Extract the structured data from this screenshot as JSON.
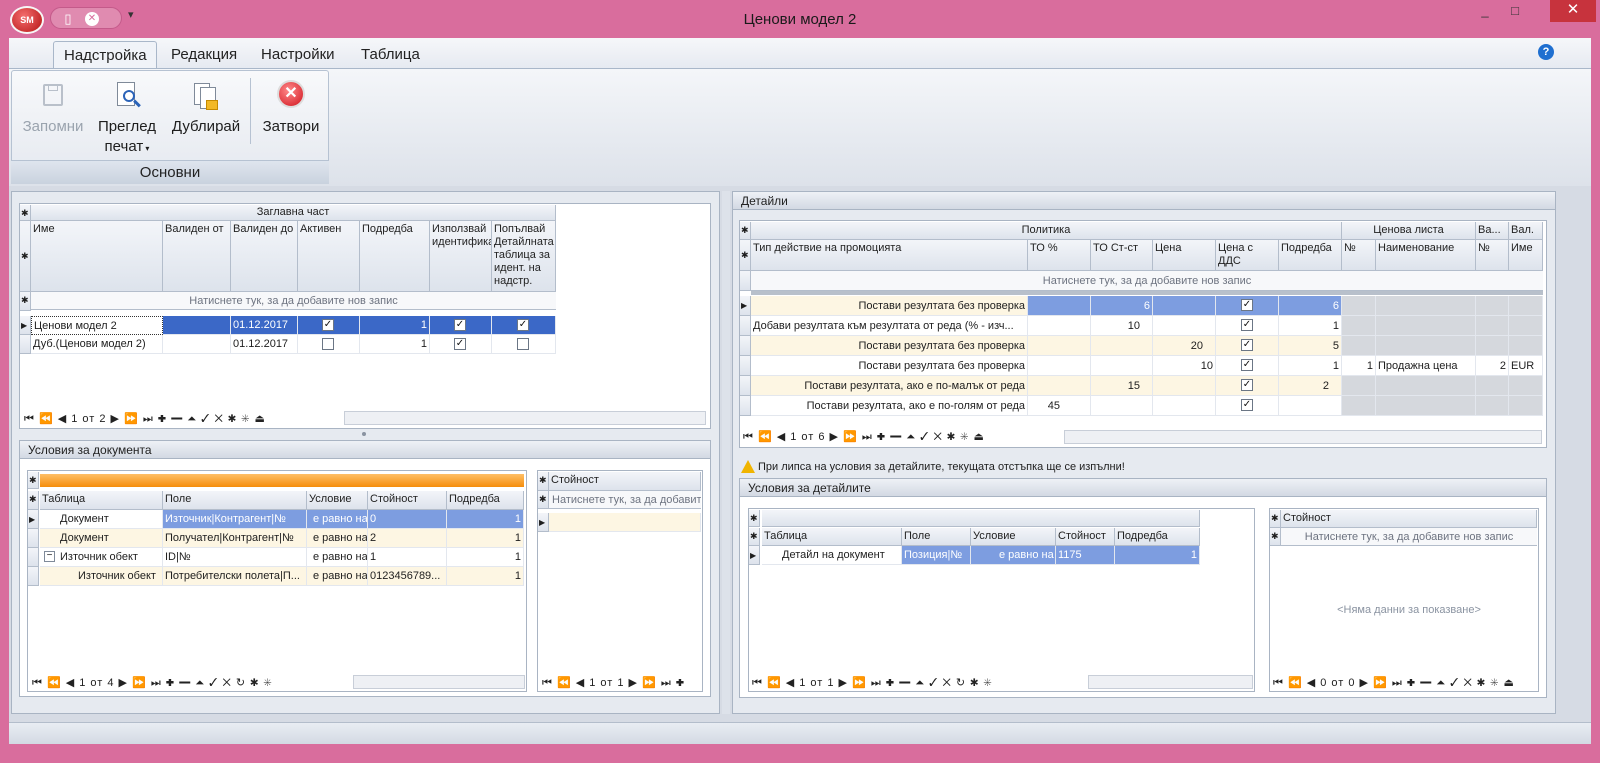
{
  "window": {
    "title": "Ценови модел 2",
    "app_badge": "SM",
    "minimize": "_",
    "maximize": "□",
    "close": "✕"
  },
  "ribbon": {
    "tabs": [
      "Надстройка",
      "Редакция",
      "Настройки",
      "Таблица"
    ],
    "help": "?",
    "buttons": {
      "save": "Запомни",
      "preview_line1": "Преглед",
      "preview_line2": "печат",
      "duplicate": "Дублирай",
      "close": "Затвори"
    },
    "group_label": "Основни"
  },
  "header_grid": {
    "band": "Заглавна част",
    "columns": [
      "Име",
      "Валиден от",
      "Валиден до",
      "Активен",
      "Подредба",
      "Използвай идентификатора",
      "Попълвай Детайлната таблица за идент. на надстр."
    ],
    "add_row": "Натиснете тук, за да добавите нов запис",
    "rows": [
      {
        "name": "Ценови модел 2",
        "from": "",
        "to": "01.12.2017",
        "active": true,
        "order": "1",
        "use_id": true,
        "fill": true
      },
      {
        "name": "Дуб.(Ценови модел 2)",
        "from": "",
        "to": "01.12.2017",
        "active": false,
        "order": "1",
        "use_id": true,
        "fill": false
      }
    ],
    "nav": "1 от 2"
  },
  "doc_conditions": {
    "title": "Условия за документа",
    "columns": [
      "Таблица",
      "Поле",
      "Условие",
      "Стойност",
      "Подредба"
    ],
    "rows": [
      {
        "table": "Документ",
        "field": "Източник|Контрагент|№",
        "cond": "е равно на",
        "value": "0",
        "order": "1"
      },
      {
        "table": "Документ",
        "field": "Получател|Контрагент|№",
        "cond": "е равно на",
        "value": "2",
        "order": "1"
      },
      {
        "table": "Източник обект",
        "field": "ID|№",
        "cond": "е равно на",
        "value": "1",
        "order": "1"
      },
      {
        "table": "Източник обект",
        "field": "Потребителски полета|П...",
        "cond": "е равно на",
        "value": "0123456789...",
        "order": "1"
      }
    ],
    "nav": "1 от 4",
    "value_panel": {
      "column": "Стойност",
      "add_row": "Натиснете тук, за да добавит",
      "nav": "1 от 1"
    }
  },
  "details": {
    "title": "Детайли",
    "bands": {
      "policy": "Политика",
      "price_list": "Ценова листа",
      "val_short": "Ва...",
      "val": "Вал."
    },
    "columns": [
      "Тип действие на промоцията",
      "ТО %",
      "ТО Ст-ст",
      "Цена",
      "Цена с ДДС",
      "Подредба",
      "№",
      "Наименование",
      "№",
      "Име"
    ],
    "add_row": "Натиснете тук, за да добавите нов запис",
    "rows": [
      {
        "type": "Постави резултата без проверка",
        "to_pct": "",
        "to_cost": "6",
        "price": "",
        "vat": true,
        "order": "6",
        "pl_no": "",
        "pl_name": "",
        "v_no": "",
        "v_name": ""
      },
      {
        "type": "Добави резултата към резултата от реда (% - изч...",
        "to_pct": "",
        "to_cost": "10",
        "price": "",
        "vat": true,
        "order": "1",
        "pl_no": "",
        "pl_name": "",
        "v_no": "",
        "v_name": ""
      },
      {
        "type": "Постави резултата без проверка",
        "to_pct": "",
        "to_cost": "",
        "price": "20",
        "vat": true,
        "order": "5",
        "pl_no": "",
        "pl_name": "",
        "v_no": "",
        "v_name": ""
      },
      {
        "type": "Постави резултата без проверка",
        "to_pct": "",
        "to_cost": "",
        "price": "10",
        "vat": true,
        "order": "1",
        "pl_no": "1",
        "pl_name": "Продажна цена",
        "v_no": "2",
        "v_name": "EUR"
      },
      {
        "type": "Постави резултата, ако е по-малък от реда",
        "to_pct": "",
        "to_cost": "15",
        "price": "",
        "vat": true,
        "order": "2",
        "pl_no": "",
        "pl_name": "",
        "v_no": "",
        "v_name": ""
      },
      {
        "type": "Постави резултата, ако е по-голям от реда",
        "to_pct": "45",
        "to_cost": "",
        "price": "",
        "vat": true,
        "order": "",
        "pl_no": "",
        "pl_name": "",
        "v_no": "",
        "v_name": ""
      }
    ],
    "nav": "1 от 6",
    "warning": "При липса на условия за детайлите, текущата отстъпка ще се изпълни!"
  },
  "detail_conditions": {
    "title": "Условия за детайлите",
    "columns": [
      "Таблица",
      "Поле",
      "Условие",
      "Стойност",
      "Подредба"
    ],
    "rows": [
      {
        "table": "Детайл на документ",
        "field": "Позиция|№",
        "cond": "е равно на",
        "value": "1175",
        "order": "1"
      }
    ],
    "nav": "1 от 1",
    "value_panel": {
      "column": "Стойност",
      "add_row": "Натиснете тук, за да добавите нов запис",
      "empty": "<Няма данни за показване>",
      "nav": "0 от 0"
    }
  },
  "icons": {
    "asterisk": "✱",
    "check": "✓",
    "pointer": "▶"
  }
}
